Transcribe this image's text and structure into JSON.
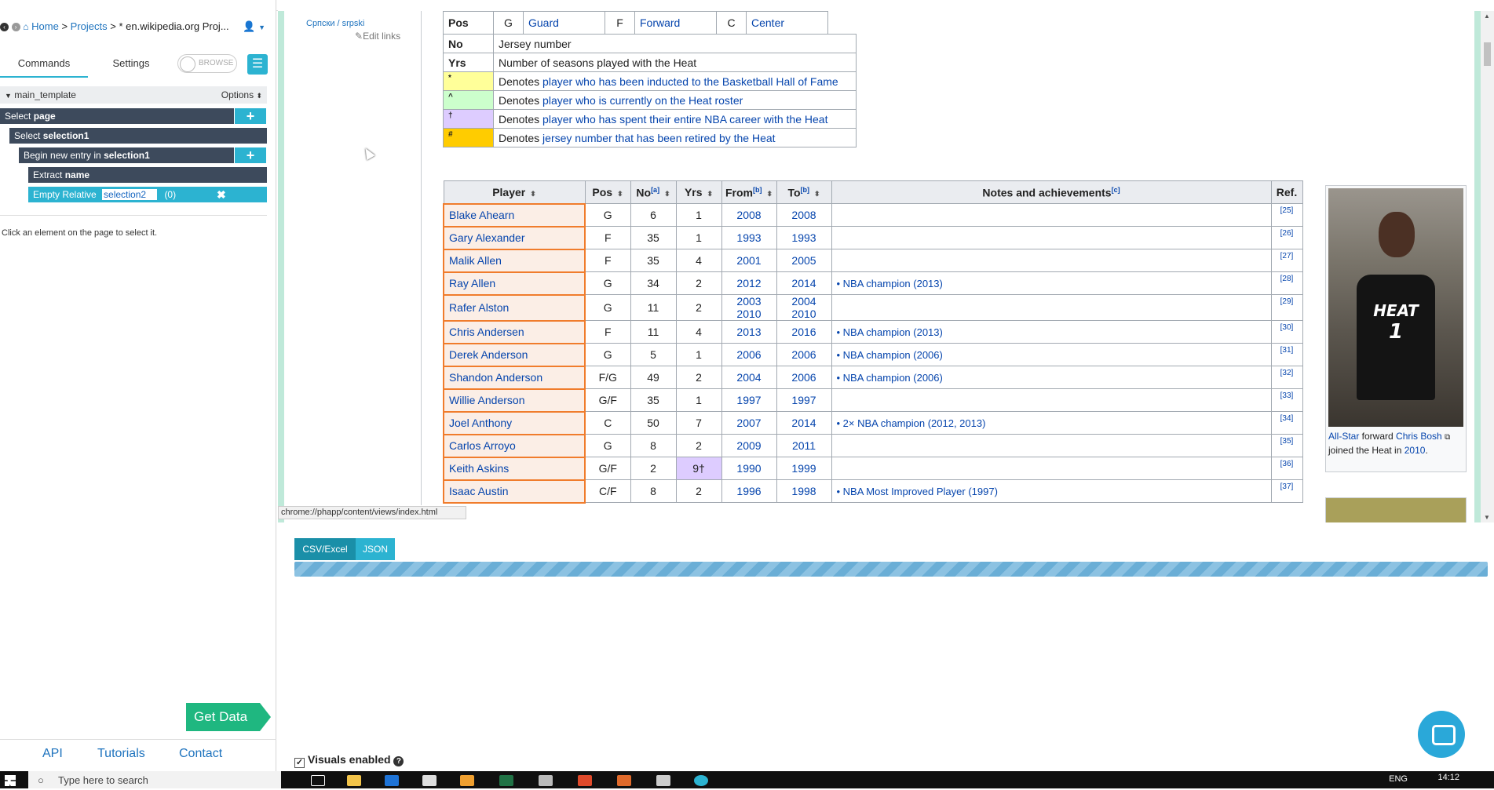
{
  "sidebar": {
    "breadcrumb": {
      "home": "Home",
      "projects": "Projects",
      "current": "* en.wikipedia.org Proj..."
    },
    "tabs": {
      "commands": "Commands",
      "settings": "Settings"
    },
    "toggle_label": "BROWSE",
    "template": {
      "name": "main_template",
      "options": "Options"
    },
    "commands": [
      {
        "verb": "Select",
        "target": "page"
      },
      {
        "verb": "Select",
        "target": "selection1"
      },
      {
        "verb": "Begin new entry in",
        "target": "selection1"
      },
      {
        "verb": "Extract",
        "target": "name"
      },
      {
        "verb": "Empty Relative",
        "target": "selection2",
        "count": "(0)"
      }
    ],
    "hint": "Click an element on the page to select it.",
    "get_data": "Get Data",
    "footer_links": {
      "api": "API",
      "tutorials": "Tutorials",
      "contact": "Contact"
    }
  },
  "browser": {
    "left_nav_link": "Српски / srpski",
    "edit_links": "Edit links",
    "status_url": "chrome://phapp/content/views/index.html",
    "legend": {
      "pos_row": {
        "label": "Pos",
        "g": "G",
        "guard": "Guard",
        "f": "F",
        "forward": "Forward",
        "c": "C",
        "center": "Center"
      },
      "rows": [
        {
          "key": "No",
          "text": "Jersey number",
          "link": "",
          "color": "#ffffff"
        },
        {
          "key": "Yrs",
          "text": "Number of seasons played with the Heat",
          "link": "",
          "color": "#ffffff"
        },
        {
          "key": "*",
          "text": "Denotes ",
          "link": "player who has been inducted to the Basketball Hall of Fame",
          "color": "#ffff99"
        },
        {
          "key": "^",
          "text": "Denotes ",
          "link": "player who is currently on the Heat roster",
          "color": "#ccffcc"
        },
        {
          "key": "†",
          "text": "Denotes ",
          "link": "player who has spent their entire NBA career with the Heat",
          "color": "#ddccff"
        },
        {
          "key": "#",
          "text": "Denotes ",
          "link": "jersey number that has been retired by the Heat",
          "color": "#ffcc00"
        }
      ]
    },
    "table": {
      "headers": {
        "player": "Player",
        "pos": "Pos",
        "no": "No",
        "no_sup": "[a]",
        "yrs": "Yrs",
        "from": "From",
        "from_sup": "[b]",
        "to": "To",
        "to_sup": "[b]",
        "notes": "Notes and achievements",
        "notes_sup": "[c]",
        "ref": "Ref."
      },
      "rows": [
        {
          "player": "Blake Ahearn",
          "pos": "G",
          "no": "6",
          "yrs": "1",
          "from": "2008",
          "to": "2008",
          "notes": "",
          "ref": "[25]"
        },
        {
          "player": "Gary Alexander",
          "pos": "F",
          "no": "35",
          "yrs": "1",
          "from": "1993",
          "to": "1993",
          "notes": "",
          "ref": "[26]"
        },
        {
          "player": "Malik Allen",
          "pos": "F",
          "no": "35",
          "yrs": "4",
          "from": "2001",
          "to": "2005",
          "notes": "",
          "ref": "[27]"
        },
        {
          "player": "Ray Allen",
          "pos": "G",
          "no": "34",
          "yrs": "2",
          "from": "2012",
          "to": "2014",
          "notes": "• NBA champion (2013)",
          "ref": "[28]"
        },
        {
          "player": "Rafer Alston",
          "pos": "G",
          "no": "11",
          "yrs": "2",
          "from": "2003 2010",
          "to": "2004 2010",
          "notes": "",
          "ref": "[29]"
        },
        {
          "player": "Chris Andersen",
          "pos": "F",
          "no": "11",
          "yrs": "4",
          "from": "2013",
          "to": "2016",
          "notes": "• NBA champion (2013)",
          "ref": "[30]"
        },
        {
          "player": "Derek Anderson",
          "pos": "G",
          "no": "5",
          "yrs": "1",
          "from": "2006",
          "to": "2006",
          "notes": "• NBA champion (2006)",
          "ref": "[31]"
        },
        {
          "player": "Shandon Anderson",
          "pos": "F/G",
          "no": "49",
          "yrs": "2",
          "from": "2004",
          "to": "2006",
          "notes": "• NBA champion (2006)",
          "ref": "[32]"
        },
        {
          "player": "Willie Anderson",
          "pos": "G/F",
          "no": "35",
          "yrs": "1",
          "from": "1997",
          "to": "1997",
          "notes": "",
          "ref": "[33]"
        },
        {
          "player": "Joel Anthony",
          "pos": "C",
          "no": "50",
          "yrs": "7",
          "from": "2007",
          "to": "2014",
          "notes": "• 2× NBA champion (2012, 2013)",
          "ref": "[34]"
        },
        {
          "player": "Carlos Arroyo",
          "pos": "G",
          "no": "8",
          "yrs": "2",
          "from": "2009",
          "to": "2011",
          "notes": "",
          "ref": "[35]"
        },
        {
          "player": "Keith Askins",
          "pos": "G/F",
          "no": "2",
          "yrs": "9†",
          "from": "1990",
          "to": "1999",
          "notes": "",
          "ref": "[36]"
        },
        {
          "player": "Isaac Austin",
          "pos": "C/F",
          "no": "8",
          "yrs": "2",
          "from": "1996",
          "to": "1998",
          "notes": "• NBA Most Improved Player (1997)",
          "ref": "[37]"
        }
      ]
    },
    "image": {
      "jersey_text": "HEAT",
      "jersey_number": "1",
      "caption": {
        "a": "All-Star",
        "b": " forward ",
        "c": "Chris Bosh",
        "d": "joined the Heat in ",
        "e": "2010",
        "f": "."
      }
    }
  },
  "data_panel": {
    "tabs": {
      "csv": "CSV/Excel",
      "json": "JSON"
    },
    "visuals_label": "Visuals enabled",
    "visuals_check": "✓"
  },
  "taskbar": {
    "search_placeholder": "Type here to search",
    "lang": "ENG",
    "time": "14:12"
  },
  "colors": {
    "accent": "#2cb3d1",
    "dark_cmd": "#3d4a5c",
    "get_data": "#1fb780",
    "highlight": "#f07c2c"
  }
}
